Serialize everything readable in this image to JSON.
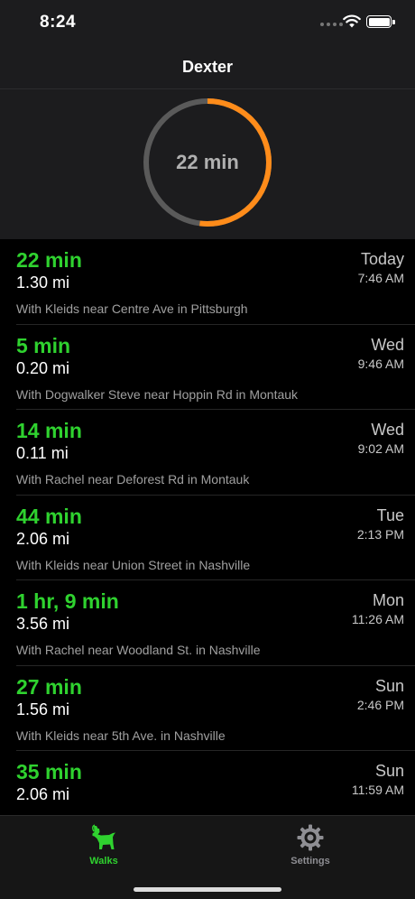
{
  "status_bar": {
    "time": "8:24"
  },
  "nav": {
    "title": "Dexter"
  },
  "summary": {
    "label": "22 min",
    "progress": 0.52,
    "colors": {
      "track": "#5a5a5a",
      "progress": "#ff8c1a"
    }
  },
  "walks": [
    {
      "duration": "22 min",
      "distance": "1.30 mi",
      "description": "With Kleids near Centre Ave in Pittsburgh",
      "day": "Today",
      "time": "7:46 AM"
    },
    {
      "duration": "5 min",
      "distance": "0.20 mi",
      "description": "With Dogwalker Steve near Hoppin Rd in Montauk",
      "day": "Wed",
      "time": "9:46 AM"
    },
    {
      "duration": "14 min",
      "distance": "0.11 mi",
      "description": "With Rachel near Deforest Rd in Montauk",
      "day": "Wed",
      "time": "9:02 AM"
    },
    {
      "duration": "44 min",
      "distance": "2.06 mi",
      "description": "With Kleids near Union Street in Nashville",
      "day": "Tue",
      "time": "2:13 PM"
    },
    {
      "duration": "1 hr, 9 min",
      "distance": "3.56 mi",
      "description": "With Rachel near Woodland St. in Nashville",
      "day": "Mon",
      "time": "11:26 AM"
    },
    {
      "duration": "27 min",
      "distance": "1.56 mi",
      "description": "With Kleids near 5th Ave. in Nashville",
      "day": "Sun",
      "time": "2:46 PM"
    },
    {
      "duration": "35 min",
      "distance": "2.06 mi",
      "description": "",
      "day": "Sun",
      "time": "11:59 AM"
    }
  ],
  "tabs": {
    "walks": {
      "label": "Walks",
      "icon": "dog-icon",
      "active": true,
      "color": "#2fd22f"
    },
    "settings": {
      "label": "Settings",
      "icon": "gear-icon",
      "active": false,
      "color": "#8e8e93"
    }
  }
}
